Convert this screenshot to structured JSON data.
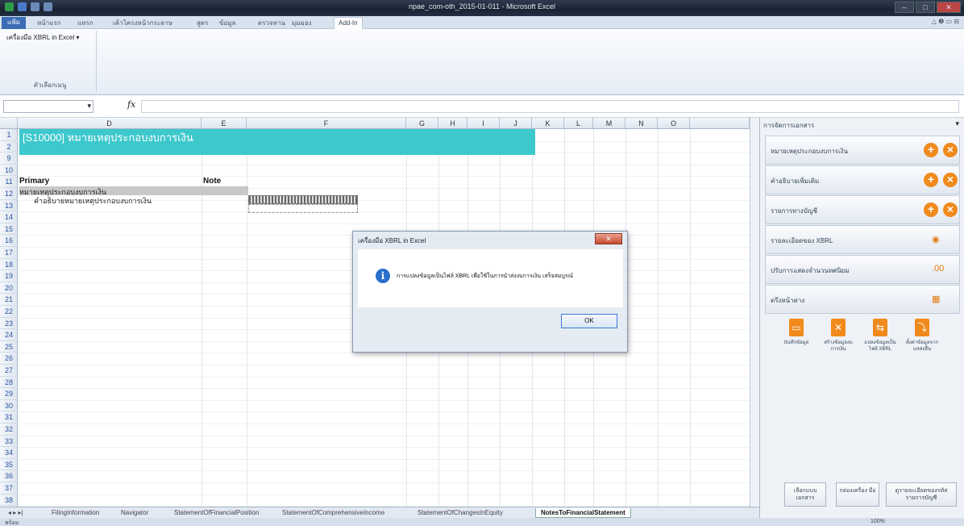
{
  "window": {
    "title": "npae_com-oth_2015-01-011 - Microsoft Excel",
    "min": "–",
    "max": "□",
    "close": "✕"
  },
  "ribbon": {
    "tabs": [
      "แฟ้ม",
      "หน้าแรก",
      "แทรก",
      "เค้าโครงหน้ากระดาษ",
      "สูตร",
      "ข้อมูล",
      "ตรวจทาน",
      "มุมมอง"
    ],
    "active_tab": "Add-In",
    "addin_button": "เครื่องมือ XBRL in Excel ▾",
    "group_label": "ตัวเลือกเมนู",
    "help": "△ ❷ ▭ ⊟"
  },
  "formula": {
    "namebox": "",
    "fx": "fx"
  },
  "columns": [
    {
      "l": "",
      "w": 22
    },
    {
      "l": "D",
      "w": 228
    },
    {
      "l": "E",
      "w": 56
    },
    {
      "l": "F",
      "w": 198
    },
    {
      "l": "G",
      "w": 40
    },
    {
      "l": "H",
      "w": 36
    },
    {
      "l": "I",
      "w": 40
    },
    {
      "l": "J",
      "w": 40
    },
    {
      "l": "K",
      "w": 40
    },
    {
      "l": "L",
      "w": 36
    },
    {
      "l": "M",
      "w": 40
    },
    {
      "l": "N",
      "w": 40
    },
    {
      "l": "O",
      "w": 40
    },
    {
      "l": "",
      "w": 74
    }
  ],
  "rows": [
    "1",
    "2",
    "9",
    "10",
    "11",
    "12",
    "13",
    "14",
    "15",
    "16",
    "17",
    "18",
    "19",
    "20",
    "21",
    "22",
    "23",
    "24",
    "25",
    "26",
    "27",
    "28",
    "29",
    "30",
    "31",
    "32",
    "33",
    "34",
    "35",
    "36",
    "37",
    "38"
  ],
  "sheet": {
    "title": "[S10000] หมายเหตุประกอบงบการเงิน",
    "primary": "Primary",
    "note": "Note",
    "row10": "หมายเหตุประกอบงบการเงิน",
    "row11": "คำอธิบายหมายเหตุประกอบงบการเงิน"
  },
  "sheet_tabs": [
    "FilingInformation",
    "Navigator",
    "StatementOfFinancialPosition",
    "StatementOfComprehensiveIncome",
    "StatementOfChangesInEquity",
    "NotesToFinancialStatement"
  ],
  "sheet_nav": "◂ ▸ ▸|",
  "status": {
    "left": "พร้อม",
    "zoom": "100%"
  },
  "taskpane": {
    "title": "การจัดการเอกสาร",
    "close": "▾",
    "rows": [
      {
        "label": "หมายเหตุประกอบงบการเงิน",
        "ctl": "+ ×"
      },
      {
        "label": "คำอธิบายเพิ่มเติม",
        "ctl": "+ ×"
      },
      {
        "label": "รายการทางบัญชี",
        "ctl": "+ ×"
      },
      {
        "label": "รายละเอียดของ XBRL",
        "ctl": "◉"
      },
      {
        "label": "ปรับการแสดงจำนวนทศนิยม",
        "ctl": ".00"
      },
      {
        "label": "ตรึงหน้าต่าง",
        "ctl": "▦"
      }
    ],
    "tools": [
      "บันทึกข้อมูล",
      "สร้างข้อมูลงบการเงิน",
      "แปลงข้อมูลเป็นไฟล์ XBRL",
      "ตั้งค่าข้อมูลจากแหล่งอื่น"
    ],
    "bottom": [
      "เลือกแบบ เอกสาร",
      "กล่องเครื่อง มือ",
      "ดูรายละเอียดของรหัส รายการบัญชี"
    ]
  },
  "dialog": {
    "title": "เครื่องมือ XBRL in Excel",
    "close": "✕",
    "message": "การแปลงข้อมูลเป็นไฟล์ XBRL เพื่อใช้ในการนำส่งงบการเงิน เสร็จสมบูรณ์",
    "ok": "OK",
    "icon": "i"
  }
}
